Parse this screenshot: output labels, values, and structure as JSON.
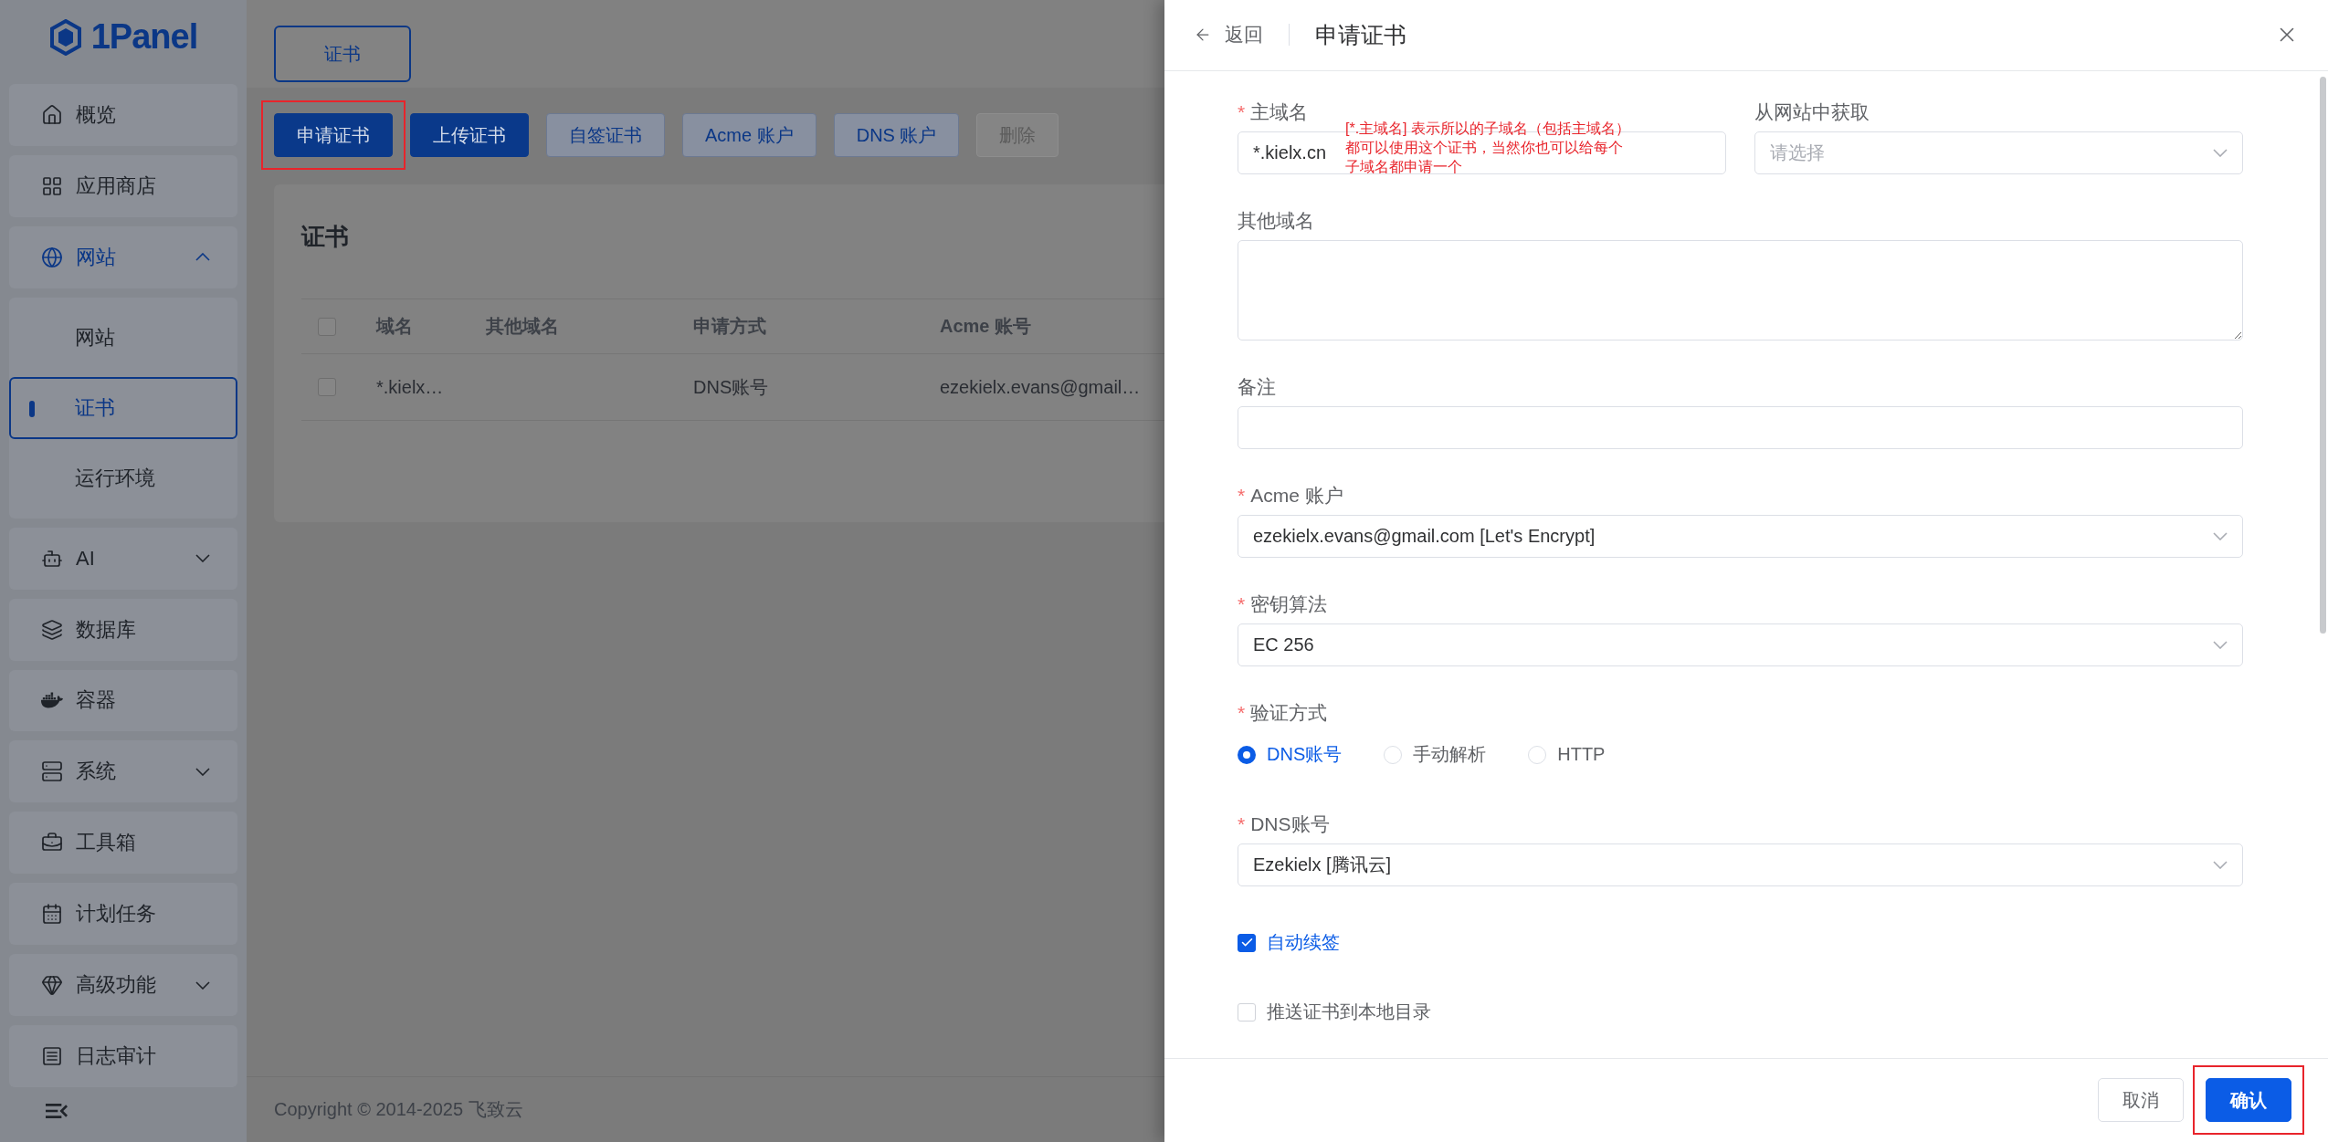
{
  "sidebar": {
    "logo": "1Panel",
    "items": [
      {
        "label": "概览",
        "kind": "link",
        "selected": false
      },
      {
        "label": "应用商店",
        "kind": "link",
        "selected": false
      },
      {
        "label": "网站",
        "kind": "group",
        "selected": true,
        "expanded": true,
        "children": [
          {
            "label": "网站",
            "selected": false
          },
          {
            "label": "证书",
            "selected": true
          },
          {
            "label": "运行环境",
            "selected": false
          }
        ]
      },
      {
        "label": "AI",
        "kind": "group",
        "selected": false,
        "expanded": false
      },
      {
        "label": "数据库",
        "kind": "link",
        "selected": false
      },
      {
        "label": "容器",
        "kind": "link",
        "selected": false
      },
      {
        "label": "系统",
        "kind": "group",
        "selected": false,
        "expanded": false
      },
      {
        "label": "工具箱",
        "kind": "link",
        "selected": false
      },
      {
        "label": "计划任务",
        "kind": "link",
        "selected": false
      },
      {
        "label": "高级功能",
        "kind": "group",
        "selected": false,
        "expanded": false
      },
      {
        "label": "日志审计",
        "kind": "link",
        "selected": false
      }
    ]
  },
  "main": {
    "tabs": [
      {
        "label": "证书",
        "selected": true
      }
    ],
    "toolbar": [
      {
        "label": "申请证书",
        "kind": "primary",
        "highlighted": true
      },
      {
        "label": "上传证书",
        "kind": "primary",
        "highlighted": false
      },
      {
        "label": "自签证书",
        "kind": "plain",
        "highlighted": false
      },
      {
        "label": "Acme 账户",
        "kind": "plain",
        "highlighted": false
      },
      {
        "label": "DNS 账户",
        "kind": "plain",
        "highlighted": false
      },
      {
        "label": "删除",
        "kind": "disabled",
        "highlighted": false
      }
    ],
    "card": {
      "title": "证书",
      "table": {
        "all_checked": false,
        "columns": [
          "域名",
          "其他域名",
          "申请方式",
          "Acme 账号"
        ],
        "rows": [
          {
            "checked": false,
            "cells": [
              "*.kielx…",
              null,
              "DNS账号",
              "ezekielx.evans@gmail…"
            ]
          }
        ]
      }
    },
    "footer": "Copyright © 2014-2025 飞致云"
  },
  "drawer": {
    "back": "返回",
    "title": "申请证书",
    "fields": [
      {
        "kind": "pair",
        "fields": [
          {
            "kind": "input",
            "label": "主域名",
            "marker": "*",
            "value": "*.kielx.cn",
            "note_lines": [
              "[*.主域名] 表示所以的子域名（包括主域名）",
              "都可以使用这个证书，当然你也可以给每个",
              "子域名都申请一个"
            ]
          },
          {
            "kind": "select",
            "label": "从网站中获取",
            "placeholder": "请选择"
          }
        ]
      },
      {
        "kind": "textarea",
        "label": "其他域名"
      },
      {
        "kind": "input",
        "label": "备注"
      },
      {
        "kind": "select",
        "label": "Acme 账户",
        "marker": "*",
        "value": "ezekielx.evans@gmail.com [Let's Encrypt]"
      },
      {
        "kind": "select",
        "label": "密钥算法",
        "marker": "*",
        "value": "EC 256"
      },
      {
        "kind": "radio",
        "label": "验证方式",
        "marker": "*",
        "options": [
          {
            "label": "DNS账号",
            "selected": true
          },
          {
            "label": "手动解析",
            "selected": false
          },
          {
            "label": "HTTP",
            "selected": false
          }
        ]
      },
      {
        "kind": "select",
        "label": "DNS账号",
        "marker": "*",
        "value": "Ezekielx [腾讯云]"
      },
      {
        "kind": "checkbox",
        "label": "自动续签",
        "checked": true
      },
      {
        "kind": "checkbox",
        "label": "推送证书到本地目录",
        "checked": false
      }
    ],
    "buttons": [
      {
        "label": "取消",
        "kind": "plain",
        "highlighted": false
      },
      {
        "label": "确认",
        "kind": "primary",
        "highlighted": true
      }
    ]
  }
}
